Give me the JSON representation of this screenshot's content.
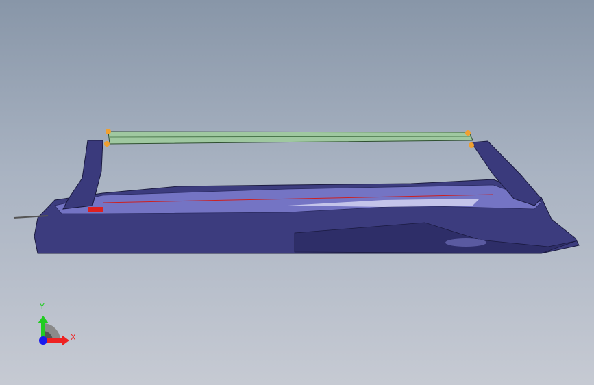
{
  "viewport": {
    "background_top": "#8896a8",
    "background_bottom": "#c6cad3",
    "model_colors": {
      "body": "#3c3c7e",
      "body_light": "#6a6ab8",
      "rail": "#9fc8a0",
      "clip": "#f0a030",
      "accent": "#cc2020"
    }
  },
  "triad": {
    "y_label": "Y",
    "x_label": "X",
    "y_color": "#22cc22",
    "x_color": "#ee2222",
    "z_color": "#1a1aee"
  }
}
